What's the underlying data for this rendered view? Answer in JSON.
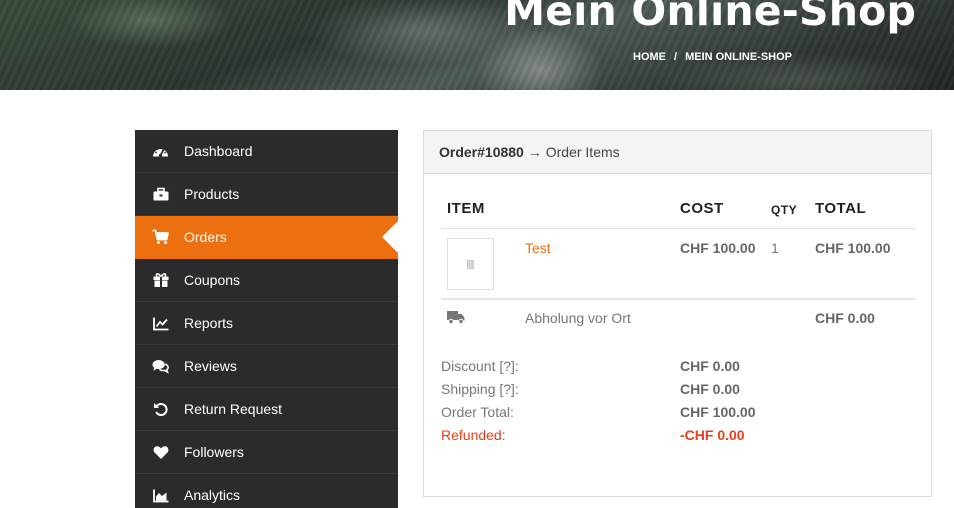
{
  "header": {
    "title": "Mein Online-Shop",
    "breadcrumb_home": "HOME",
    "breadcrumb_sep": "/",
    "breadcrumb_current": "MEIN ONLINE-SHOP"
  },
  "sidebar": {
    "active_color": "#ec6f10",
    "items": [
      {
        "label": "Dashboard",
        "icon": "dashboard-gauge-icon"
      },
      {
        "label": "Products",
        "icon": "briefcase-icon"
      },
      {
        "label": "Orders",
        "icon": "shopping-cart-icon",
        "active": true
      },
      {
        "label": "Coupons",
        "icon": "gift-icon"
      },
      {
        "label": "Reports",
        "icon": "line-chart-icon"
      },
      {
        "label": "Reviews",
        "icon": "comments-icon"
      },
      {
        "label": "Return Request",
        "icon": "undo-icon"
      },
      {
        "label": "Followers",
        "icon": "heart-icon"
      },
      {
        "label": "Analytics",
        "icon": "area-chart-icon"
      }
    ]
  },
  "order": {
    "number": "Order#10880",
    "section": "→ Order Items",
    "columns": {
      "item": "ITEM",
      "cost": "COST",
      "qty": "QTY",
      "total": "TOTAL"
    },
    "items": [
      {
        "name": "Test",
        "cost": "CHF 100.00",
        "qty": "1",
        "total": "CHF 100.00"
      }
    ],
    "shipping_line": {
      "icon": "truck-icon",
      "name": "Abholung vor Ort",
      "total": "CHF 0.00"
    },
    "totals": {
      "discount_label": "Discount [?]:",
      "discount_value": "CHF 0.00",
      "shipping_label": "Shipping [?]:",
      "shipping_value": "CHF 0.00",
      "order_total_label": "Order Total:",
      "order_total_value": "CHF 100.00",
      "refunded_label": "Refunded:",
      "refunded_value": "-CHF 0.00"
    }
  }
}
